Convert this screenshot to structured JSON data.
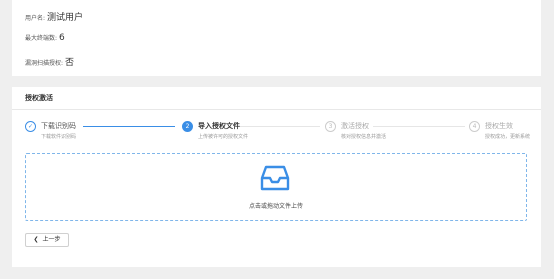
{
  "info": {
    "username_label": "用户名:",
    "username_value": "测试用户",
    "max_terminals_label": "最大终端数:",
    "max_terminals_value": "6",
    "leak_scan_label": "漏洞扫描授权:",
    "leak_scan_value": "否"
  },
  "activation": {
    "title": "授权激活",
    "steps": [
      {
        "number": "✓",
        "title": "下载识别码",
        "desc": "下载软件识别码",
        "status": "done"
      },
      {
        "number": "2",
        "title": "导入授权文件",
        "desc": "上传被许可的授权文件",
        "status": "active"
      },
      {
        "number": "3",
        "title": "激活授权",
        "desc": "核对授权信息并激活",
        "status": "wait"
      },
      {
        "number": "4",
        "title": "授权生效",
        "desc": "授权成功，更新系统",
        "status": "wait"
      }
    ],
    "upload_text": "点击或拖动文件上传",
    "prev_button": "上一步",
    "accent_color": "#3a8ee6"
  }
}
